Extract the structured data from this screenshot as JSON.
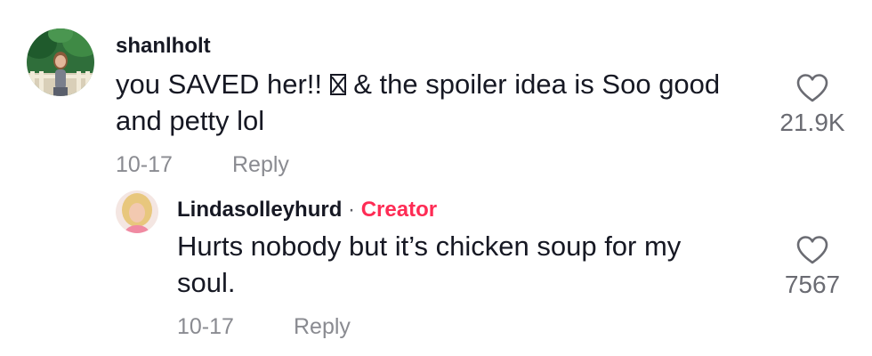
{
  "comments": [
    {
      "username": "shanlholt",
      "text_before_emoji": "you SAVED her!! ",
      "emoji": "unsupported-emoji-glyph",
      "text_after_emoji": " & the spoiler idea is Soo good and petty lol",
      "date": "10-17",
      "reply_label": "Reply",
      "likes": "21.9K",
      "like_icon": "heart-outline-icon"
    }
  ],
  "replies": [
    {
      "username": "Lindasolleyhurd",
      "separator": "·",
      "badge": "Creator",
      "text": "Hurts nobody but it’s chicken soup for my soul.",
      "date": "10-17",
      "reply_label": "Reply",
      "likes": "7567",
      "like_icon": "heart-outline-icon"
    }
  ],
  "colors": {
    "text": "#161823",
    "muted": "#8a8b91",
    "creator_badge": "#fe2c55"
  }
}
